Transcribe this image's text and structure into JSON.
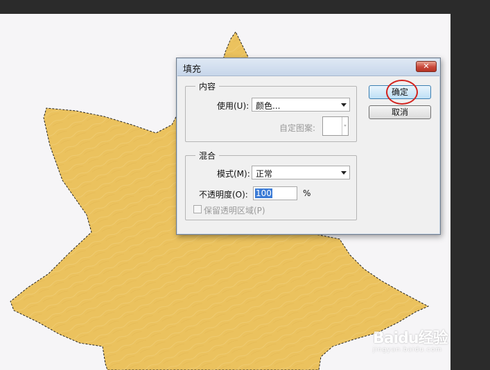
{
  "dialog": {
    "title": "填充",
    "content_group": {
      "legend": "内容",
      "use_label": "使用(U):",
      "use_value": "颜色...",
      "custom_pattern_label": "自定图案:"
    },
    "blend_group": {
      "legend": "混合",
      "mode_label": "模式(M):",
      "mode_value": "正常",
      "opacity_label": "不透明度(O):",
      "opacity_value": "100",
      "opacity_unit": "%",
      "preserve_label": "保留透明区域(P)",
      "preserve_checked": false
    },
    "buttons": {
      "ok": "确定",
      "cancel": "取消"
    },
    "close_icon": "close-icon"
  },
  "canvas": {
    "selection_fill_color": "#ebc25e",
    "background_color": "#f6f5f7"
  },
  "watermark": {
    "logo": "Baidu经验",
    "url": "jingyan.baidu.com"
  }
}
